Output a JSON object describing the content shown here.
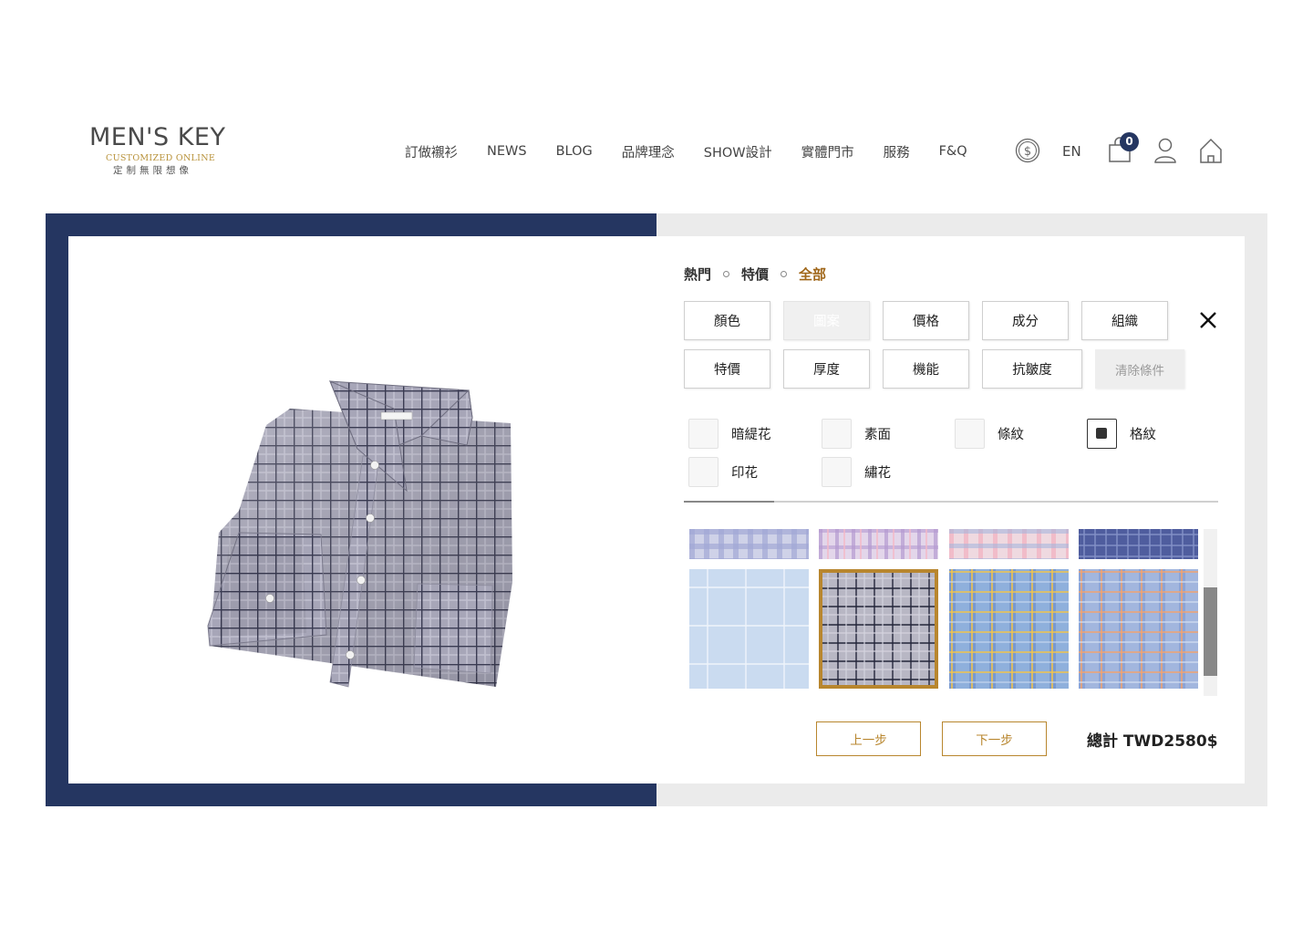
{
  "header": {
    "logo": {
      "brand": "MEN'S KEY",
      "tagline": "CUSTOMIZED ONLINE",
      "slogan": "定制無限想像"
    },
    "nav": [
      "訂做襯衫",
      "NEWS",
      "BLOG",
      "品牌理念",
      "SHOW設計",
      "實體門市",
      "服務",
      "F&Q"
    ],
    "language": "EN",
    "cart_count": "0"
  },
  "filters": {
    "tabs": [
      {
        "label": "熱門",
        "active": false
      },
      {
        "label": "特價",
        "active": false
      },
      {
        "label": "全部",
        "active": true
      }
    ],
    "row1": [
      "顏色",
      "圖案",
      "價格",
      "成分",
      "組織"
    ],
    "row2": [
      "特價",
      "厚度",
      "機能",
      "抗皺度"
    ],
    "clear_label": "清除條件",
    "pattern_options": [
      {
        "label": "暗緹花",
        "checked": false
      },
      {
        "label": "素面",
        "checked": false
      },
      {
        "label": "條紋",
        "checked": false
      },
      {
        "label": "格紋",
        "checked": true
      },
      {
        "label": "印花",
        "checked": false
      },
      {
        "label": "繡花",
        "checked": false
      }
    ]
  },
  "swatches": {
    "selected_index": 5
  },
  "footer": {
    "prev_label": "上一步",
    "next_label": "下一步",
    "total": "總計 TWD2580$"
  },
  "colors": {
    "navy": "#253661",
    "gold": "#b8862e",
    "active_tab": "#a0671a"
  }
}
